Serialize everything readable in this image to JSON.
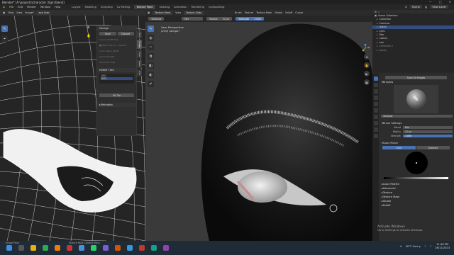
{
  "window": {
    "title": "Blender* [A:\\projects\\character 3\\girl.blend]",
    "controls": [
      "—",
      "□",
      "✕"
    ]
  },
  "menubar": {
    "menus": [
      "File",
      "Edit",
      "Render",
      "Window",
      "Help"
    ],
    "workspaces": [
      "Layout",
      "Modeling",
      "Sculpting",
      "UV Editing",
      "Texture Paint",
      "Shading",
      "Animation",
      "Rendering",
      "Compositing"
    ],
    "active_workspace": "Texture Paint",
    "scene": "Scene",
    "view_layer": "View Layer"
  },
  "image_editor": {
    "header": [
      "View",
      "View",
      "Image*",
      "eye liner"
    ],
    "npanel": {
      "image_label": "Image",
      "save": "Save",
      "discard": "Discard",
      "dim_rows": [
        "Source     UDIM Tiles",
        "●UDIM Tiles    D:\\...\\texture",
        "Color Space   sRGB",
        "Alpha    Straight",
        "Half Float     Tiles"
      ],
      "udim_label": "UDIM Tiles",
      "tiles": [
        "1001",
        "1002"
      ],
      "fill_tile": "Fill Tile",
      "metadata": "Metadata"
    },
    "tabs": [
      "Tool",
      "Image",
      "View",
      "Mask",
      "UVs"
    ]
  },
  "viewport": {
    "header": [
      "Texture Paint",
      "View",
      "Texture Slots",
      "Brush",
      "Texture",
      "Texture Mask",
      "Stroke",
      "Falloff",
      "Cursor"
    ],
    "brush_name": "TexDraw",
    "blend_label": "Mix",
    "radius_label": "Radius",
    "radius_value": "22 px",
    "strength_label": "Strength",
    "strength_value": "1.000",
    "info_line1": "User Perspective",
    "info_line2": "(230) rackgirl"
  },
  "outliner": {
    "title": "Scene Collection",
    "rows": [
      "Collection",
      "Cameras",
      "lashes",
      "eyes",
      "Tear",
      "Lashes",
      "hair",
      "Collection 2",
      "bones"
    ],
    "selected_row": "lashes"
  },
  "properties": {
    "image_btn": "Save All Images",
    "brushes_label": "Brushes",
    "brush_name": "TexDraw",
    "settings_label": "Brush Settings",
    "blend": "Mix",
    "radius": "22 px",
    "strength": "1.000",
    "color_picker_label": "Color Picker",
    "color_tabs": [
      "Color",
      "Gradient"
    ],
    "sections": [
      "Color Palette",
      "Advanced",
      "Texture",
      "Texture Mask",
      "Stroke",
      "Falloff"
    ]
  },
  "watermark": {
    "line1": "Activate Windows",
    "line2": "Go to Settings to activate Windows."
  },
  "taskbar": {
    "apps": [
      "Image Paint",
      "Texture Paint Context Menu"
    ],
    "weather": "30°C Sunny",
    "time": "11:46 PM",
    "date": "26/11/2023"
  }
}
